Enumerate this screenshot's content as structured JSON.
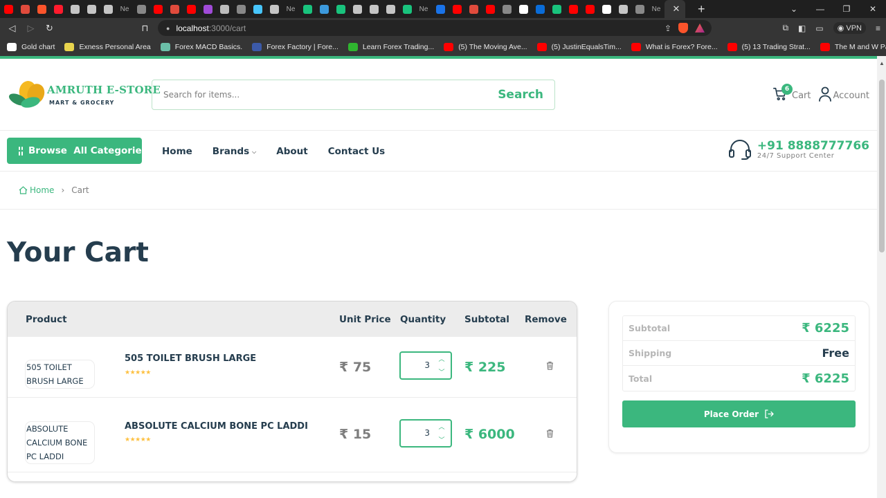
{
  "browser": {
    "tab_items": [
      {
        "icon": "youtube-icon",
        "color": "#ff0000"
      },
      {
        "icon": "gmail-icon",
        "color": "#e04b3c"
      },
      {
        "icon": "brave-icon",
        "color": "#fb542b"
      },
      {
        "icon": "opera-icon",
        "color": "#ff1b2d"
      },
      {
        "icon": "brave-search-icon",
        "color": "#c5c5c5"
      },
      {
        "icon": "globe-icon",
        "color": "#c5c5c5"
      },
      {
        "icon": "lexical-icon",
        "color": "#c5c5c5"
      },
      {
        "text": "Ne"
      },
      {
        "icon": "loading-icon",
        "color": "#888888"
      },
      {
        "icon": "youtube-icon",
        "color": "#ff0000"
      },
      {
        "icon": "gmail-icon",
        "color": "#e04b3c"
      },
      {
        "icon": "youtube-icon",
        "color": "#ff0000"
      },
      {
        "icon": "chat-icon",
        "color": "#a04bd8"
      },
      {
        "icon": "arrow-icon",
        "color": "#bcbcbc"
      },
      {
        "icon": "loading-icon",
        "color": "#888888"
      },
      {
        "icon": "flutter-icon",
        "color": "#47c5fb"
      },
      {
        "icon": "brave-search-icon",
        "color": "#c5c5c5"
      },
      {
        "text": "Ne"
      },
      {
        "icon": "chatgpt-icon",
        "color": "#19c37d"
      },
      {
        "icon": "figma-icon",
        "color": "#3c99dc"
      },
      {
        "icon": "chatgpt-icon",
        "color": "#19c37d"
      },
      {
        "icon": "brave-search-icon",
        "color": "#c5c5c5"
      },
      {
        "icon": "brave-search-icon",
        "color": "#c5c5c5"
      },
      {
        "icon": "brave-search-icon",
        "color": "#c5c5c5"
      },
      {
        "icon": "chatgpt-icon",
        "color": "#19c37d"
      },
      {
        "text": "Ne"
      },
      {
        "icon": "k-icon",
        "color": "#1a73e8"
      },
      {
        "icon": "youtube-icon",
        "color": "#ff0000"
      },
      {
        "icon": "gmail-icon",
        "color": "#e04b3c"
      },
      {
        "icon": "youtube-icon",
        "color": "#ff0000"
      },
      {
        "icon": "loading-icon",
        "color": "#888888"
      },
      {
        "icon": "github-icon",
        "color": "#ffffff"
      },
      {
        "icon": "onedrive-icon",
        "color": "#0a6cd8"
      },
      {
        "icon": "chatgpt-icon",
        "color": "#19c37d"
      },
      {
        "icon": "youtube-icon",
        "color": "#ff0000"
      },
      {
        "icon": "youtube-icon",
        "color": "#ff0000"
      },
      {
        "icon": "medium-icon",
        "color": "#ffffff"
      },
      {
        "icon": "globe-icon",
        "color": "#c5c5c5"
      },
      {
        "icon": "loading-icon",
        "color": "#888888"
      },
      {
        "text": "Ne"
      }
    ],
    "active_close": "✕",
    "new_tab": "+",
    "url_host": "localhost",
    "url_path": ":3000/cart",
    "vpn_label": "VPN",
    "bookmarks": [
      {
        "label": "Gold chart",
        "color": "#ffffff"
      },
      {
        "label": "Exness Personal Area",
        "color": "#e8d44d"
      },
      {
        "label": "Forex MACD Basics.",
        "color": "#6bbfa8"
      },
      {
        "label": "Forex Factory | Fore...",
        "color": "#3c5aa8"
      },
      {
        "label": "Learn Forex Trading...",
        "color": "#2fb52f"
      },
      {
        "label": "(5) The Moving Ave...",
        "color": "#ff0000"
      },
      {
        "label": "(5) JustinEqualsTim...",
        "color": "#ff0000"
      },
      {
        "label": "What is Forex? Fore...",
        "color": "#ff0000"
      },
      {
        "label": "(5) 13 Trading Strat...",
        "color": "#ff0000"
      },
      {
        "label": "The M and W Patte...",
        "color": "#ff0000"
      }
    ]
  },
  "header": {
    "logo_title": "AMRUTH E-STORE",
    "logo_sub": "MART & GROCERY",
    "search_placeholder": "Search for items...",
    "search_button": "Search",
    "cart_label": "Cart",
    "cart_count": "6",
    "account_label": "Account"
  },
  "nav": {
    "browse_label": "Browse  All Categories",
    "items": [
      "Home",
      "Brands",
      "About",
      "Contact Us"
    ],
    "phone": "+91 8888777766",
    "support_text": "24/7 Support Center"
  },
  "breadcrumb": {
    "home": "Home",
    "separator": "›",
    "current": "Cart"
  },
  "cart": {
    "title": "Your Cart",
    "columns": {
      "product": "Product",
      "unit_price": "Unit Price",
      "quantity": "Quantity",
      "subtotal": "Subtotal",
      "remove": "Remove"
    },
    "items": [
      {
        "img_alt": "505 TOILET BRUSH LARGE",
        "name": "505 TOILET BRUSH LARGE",
        "rating": 5,
        "stars": "★★★★★",
        "price": "₹ 75",
        "qty": "3",
        "subtotal": "₹ 225"
      },
      {
        "img_alt": "ABSOLUTE CALCIUM BONE PC LADDI",
        "name": "ABSOLUTE CALCIUM BONE PC LADDI",
        "rating": 5,
        "stars": "★★★★★",
        "price": "₹ 15",
        "qty": "3",
        "subtotal": "₹ 6000"
      }
    ]
  },
  "summary": {
    "subtotal_label": "Subtotal",
    "subtotal_value": "₹ 6225",
    "shipping_label": "Shipping",
    "shipping_value": "Free",
    "total_label": "Total",
    "total_value": "₹ 6225",
    "place_order": "Place Order"
  },
  "colors": {
    "brand_green": "#3bb77e",
    "heading": "#253d4e",
    "muted": "#7e7e7e",
    "star": "#fdc040"
  }
}
